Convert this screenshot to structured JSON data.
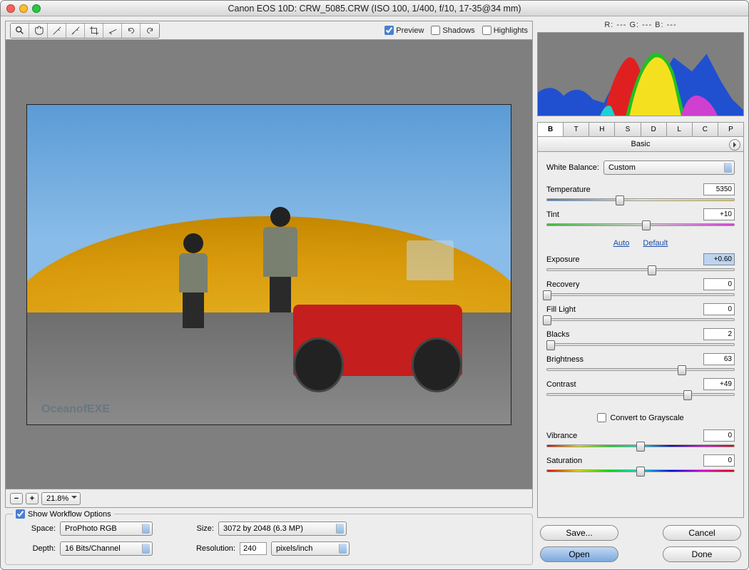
{
  "window": {
    "title": "Canon EOS 10D:  CRW_5085.CRW  (ISO 100, 1/400, f/10, 17-35@34 mm)"
  },
  "toolbar": {
    "preview_label": "Preview",
    "shadows_label": "Shadows",
    "highlights_label": "Highlights",
    "preview_checked": true,
    "shadows_checked": false,
    "highlights_checked": false,
    "tools": [
      "zoom",
      "hand",
      "white-balance",
      "color-sampler",
      "crop",
      "straighten",
      "rotate-ccw",
      "rotate-cw"
    ]
  },
  "zoom": {
    "level": "21.8%"
  },
  "workflow": {
    "show_label": "Show Workflow Options",
    "space_label": "Space:",
    "space_value": "ProPhoto RGB",
    "depth_label": "Depth:",
    "depth_value": "16 Bits/Channel",
    "size_label": "Size:",
    "size_value": "3072 by 2048  (6.3 MP)",
    "resolution_label": "Resolution:",
    "resolution_value": "240",
    "resolution_unit": "pixels/inch"
  },
  "readout": {
    "text": "R: ---   G: ---   B: ---"
  },
  "tabs": [
    "B",
    "T",
    "H",
    "S",
    "D",
    "L",
    "C",
    "P"
  ],
  "panel": {
    "title": "Basic"
  },
  "basic": {
    "wb_label": "White Balance:",
    "wb_value": "Custom",
    "temperature": {
      "label": "Temperature",
      "value": "5350",
      "pos": 39
    },
    "tint": {
      "label": "Tint",
      "value": "+10",
      "pos": 53
    },
    "auto": "Auto",
    "default": "Default",
    "exposure": {
      "label": "Exposure",
      "value": "+0.60",
      "pos": 56,
      "highlighted": true
    },
    "recovery": {
      "label": "Recovery",
      "value": "0",
      "pos": 0
    },
    "fill_light": {
      "label": "Fill Light",
      "value": "0",
      "pos": 0
    },
    "blacks": {
      "label": "Blacks",
      "value": "2",
      "pos": 2
    },
    "brightness": {
      "label": "Brightness",
      "value": "63",
      "pos": 72
    },
    "contrast": {
      "label": "Contrast",
      "value": "+49",
      "pos": 75
    },
    "grayscale_label": "Convert to Grayscale",
    "vibrance": {
      "label": "Vibrance",
      "value": "0",
      "pos": 50
    },
    "saturation": {
      "label": "Saturation",
      "value": "0",
      "pos": 50
    }
  },
  "buttons": {
    "save": "Save...",
    "open": "Open",
    "cancel": "Cancel",
    "done": "Done"
  },
  "watermark": "OceanofEXE"
}
